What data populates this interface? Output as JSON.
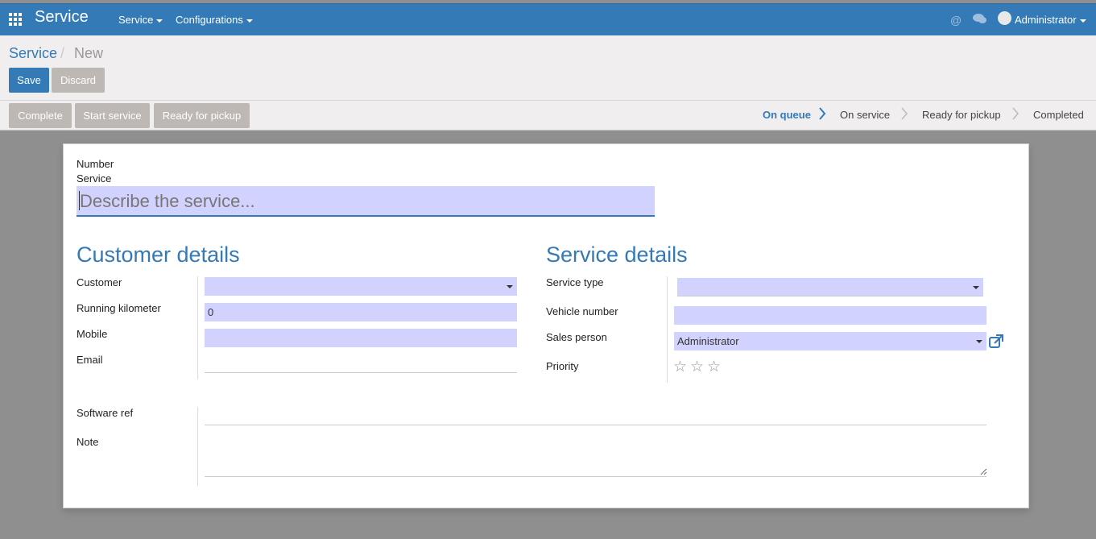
{
  "navbar": {
    "app_title": "Service",
    "menus": [
      "Service",
      "Configurations"
    ],
    "user": "Administrator",
    "icons": [
      "apps-grid-icon",
      "at-icon",
      "chat-icon",
      "avatar"
    ]
  },
  "breadcrumb": {
    "parent": "Service",
    "separator": "/",
    "current": "New"
  },
  "actions": {
    "save": "Save",
    "discard": "Discard"
  },
  "status_buttons": [
    "Complete",
    "Start service",
    "Ready for pickup"
  ],
  "stages": [
    {
      "label": "On queue",
      "active": true
    },
    {
      "label": "On service",
      "active": false
    },
    {
      "label": "Ready for pickup",
      "active": false
    },
    {
      "label": "Completed",
      "active": false
    }
  ],
  "form": {
    "number_label": "Number",
    "service_label": "Service",
    "service_placeholder": "Describe the service...",
    "customer_section": {
      "title": "Customer details",
      "customer_label": "Customer",
      "customer_value": "",
      "running_km_label": "Running kilometer",
      "running_km_value": "0",
      "mobile_label": "Mobile",
      "mobile_value": "",
      "email_label": "Email",
      "email_value": ""
    },
    "service_section": {
      "title": "Service details",
      "service_type_label": "Service type",
      "service_type_value": "",
      "vehicle_label": "Vehicle number",
      "vehicle_value": "",
      "sales_person_label": "Sales person",
      "sales_person_value": "Administrator",
      "priority_label": "Priority",
      "priority_stars": 3,
      "priority_value": 0
    },
    "software_ref_label": "Software ref",
    "software_ref_value": "",
    "note_label": "Note",
    "note_value": ""
  },
  "colors": {
    "brand": "#337ab7",
    "field_bg": "#d2d2ff",
    "secondary_btn": "#bdb8b4"
  }
}
